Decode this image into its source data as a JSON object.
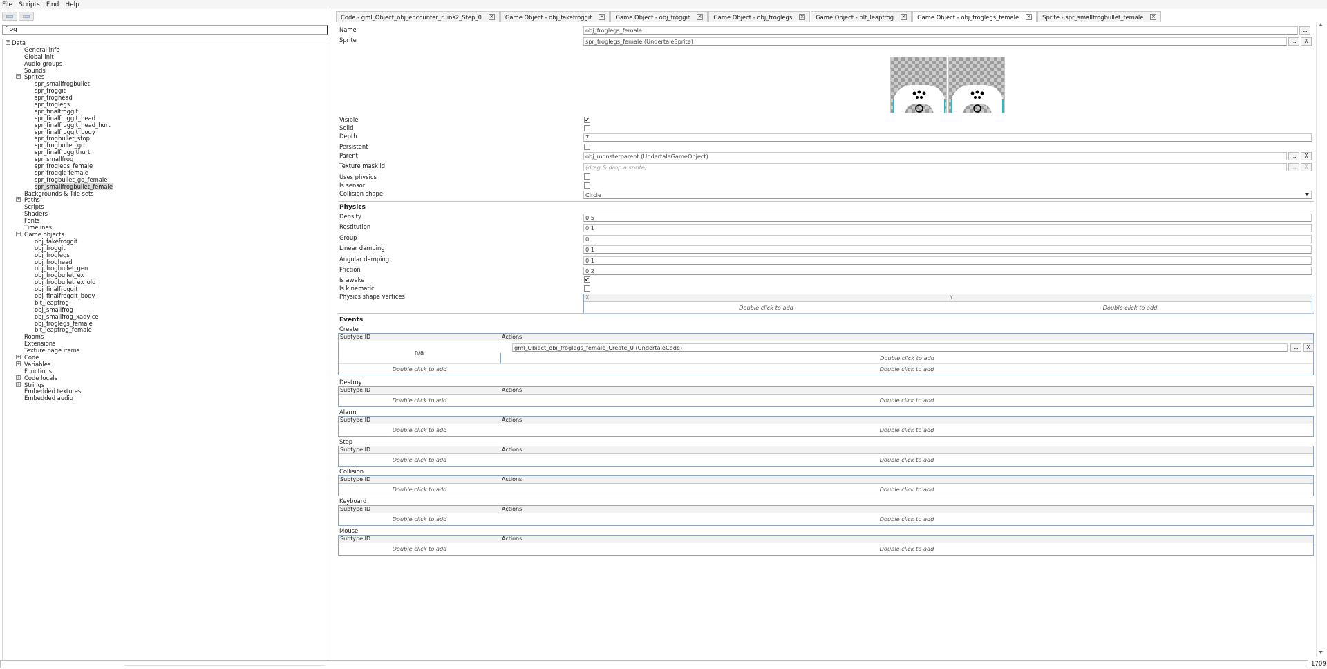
{
  "menu": {
    "items": [
      "File",
      "Scripts",
      "Find",
      "Help"
    ]
  },
  "search": {
    "value": "frog"
  },
  "tree": [
    {
      "label": "Data",
      "level": 0,
      "expander": "−"
    },
    {
      "label": "General info",
      "level": 1
    },
    {
      "label": "Global init",
      "level": 1
    },
    {
      "label": "Audio groups",
      "level": 1
    },
    {
      "label": "Sounds",
      "level": 1
    },
    {
      "label": "Sprites",
      "level": 1,
      "expander": "−"
    },
    {
      "label": "spr_smallfrogbullet",
      "level": 2
    },
    {
      "label": "spr_froggit",
      "level": 2
    },
    {
      "label": "spr_froghead",
      "level": 2
    },
    {
      "label": "spr_froglegs",
      "level": 2
    },
    {
      "label": "spr_finalfroggit",
      "level": 2
    },
    {
      "label": "spr_finalfroggit_head",
      "level": 2
    },
    {
      "label": "spr_finalfroggit_head_hurt",
      "level": 2
    },
    {
      "label": "spr_finalfroggit_body",
      "level": 2
    },
    {
      "label": "spr_frogbullet_stop",
      "level": 2
    },
    {
      "label": "spr_frogbullet_go",
      "level": 2
    },
    {
      "label": "spr_finalfroggithurt",
      "level": 2
    },
    {
      "label": "spr_smallfrog",
      "level": 2
    },
    {
      "label": "spr_froglegs_female",
      "level": 2
    },
    {
      "label": "spr_froggit_female",
      "level": 2
    },
    {
      "label": "spr_frogbullet_go_female",
      "level": 2
    },
    {
      "label": "spr_smallfrogbullet_female",
      "level": 2,
      "selected": true
    },
    {
      "label": "Backgrounds & Tile sets",
      "level": 1
    },
    {
      "label": "Paths",
      "level": 1,
      "expander": "+"
    },
    {
      "label": "Scripts",
      "level": 1
    },
    {
      "label": "Shaders",
      "level": 1
    },
    {
      "label": "Fonts",
      "level": 1
    },
    {
      "label": "Timelines",
      "level": 1
    },
    {
      "label": "Game objects",
      "level": 1,
      "expander": "−"
    },
    {
      "label": "obj_fakefroggit",
      "level": 2
    },
    {
      "label": "obj_froggit",
      "level": 2
    },
    {
      "label": "obj_froglegs",
      "level": 2
    },
    {
      "label": "obj_froghead",
      "level": 2
    },
    {
      "label": "obj_frogbullet_gen",
      "level": 2
    },
    {
      "label": "obj_frogbullet_ex",
      "level": 2
    },
    {
      "label": "obj_frogbullet_ex_old",
      "level": 2
    },
    {
      "label": "obj_finalfroggit",
      "level": 2
    },
    {
      "label": "obj_finalfroggit_body",
      "level": 2
    },
    {
      "label": "blt_leapfrog",
      "level": 2
    },
    {
      "label": "obj_smallfrog",
      "level": 2
    },
    {
      "label": "obj_smallfrog_xadvice",
      "level": 2
    },
    {
      "label": "obj_froglegs_female",
      "level": 2
    },
    {
      "label": "blt_leapfrog_female",
      "level": 2
    },
    {
      "label": "Rooms",
      "level": 1
    },
    {
      "label": "Extensions",
      "level": 1
    },
    {
      "label": "Texture page items",
      "level": 1
    },
    {
      "label": "Code",
      "level": 1,
      "expander": "+"
    },
    {
      "label": "Variables",
      "level": 1,
      "expander": "+"
    },
    {
      "label": "Functions",
      "level": 1
    },
    {
      "label": "Code locals",
      "level": 1,
      "expander": "+"
    },
    {
      "label": "Strings",
      "level": 1,
      "expander": "+"
    },
    {
      "label": "Embedded textures",
      "level": 1
    },
    {
      "label": "Embedded audio",
      "level": 1
    }
  ],
  "tabs": [
    {
      "label": "Code - gml_Object_obj_encounter_ruins2_Step_0"
    },
    {
      "label": "Game Object - obj_fakefroggit"
    },
    {
      "label": "Game Object - obj_froggit"
    },
    {
      "label": "Game Object - obj_froglegs"
    },
    {
      "label": "Game Object - blt_leapfrog"
    },
    {
      "label": "Game Object - obj_froglegs_female",
      "active": true
    },
    {
      "label": "Sprite - spr_smallfrogbullet_female"
    }
  ],
  "props": {
    "name_label": "Name",
    "name_value": "obj_froglegs_female",
    "sprite_label": "Sprite",
    "sprite_value": "spr_froglegs_female (UndertaleSprite)",
    "visible_label": "Visible",
    "visible_checked": true,
    "solid_label": "Solid",
    "solid_checked": false,
    "depth_label": "Depth",
    "depth_value": "7",
    "persistent_label": "Persistent",
    "persistent_checked": false,
    "parent_label": "Parent",
    "parent_value": "obj_monsterparent (UndertaleGameObject)",
    "texmask_label": "Texture mask id",
    "texmask_placeholder": "(drag & drop a sprite)",
    "usesphysics_label": "Uses physics",
    "usesphysics_checked": false,
    "issensor_label": "Is sensor",
    "issensor_checked": false,
    "collision_label": "Collision shape",
    "collision_value": "Circle"
  },
  "physics": {
    "title": "Physics",
    "density_label": "Density",
    "density_value": "0.5",
    "restitution_label": "Restitution",
    "restitution_value": "0.1",
    "group_label": "Group",
    "group_value": "0",
    "lineardamping_label": "Linear damping",
    "lineardamping_value": "0.1",
    "angulardamping_label": "Angular damping",
    "angulardamping_value": "0.1",
    "friction_label": "Friction",
    "friction_value": "0.2",
    "isawake_label": "Is awake",
    "isawake_checked": true,
    "iskinematic_label": "Is kinematic",
    "iskinematic_checked": false,
    "vertices_label": "Physics shape vertices",
    "col_x": "X",
    "col_y": "Y",
    "add_text": "Double click to add"
  },
  "events": {
    "title": "Events",
    "col_subtype": "Subtype ID",
    "col_actions": "Actions",
    "add_text": "Double click to add",
    "create_na": "n/a",
    "create_action": "gml_Object_obj_froglegs_female_Create_0 (UndertaleCode)",
    "groups": [
      "Create",
      "Destroy",
      "Alarm",
      "Step",
      "Collision",
      "Keyboard",
      "Mouse"
    ]
  },
  "status": {
    "number": "1709"
  },
  "buttons": {
    "dots": "...",
    "x": "X"
  }
}
